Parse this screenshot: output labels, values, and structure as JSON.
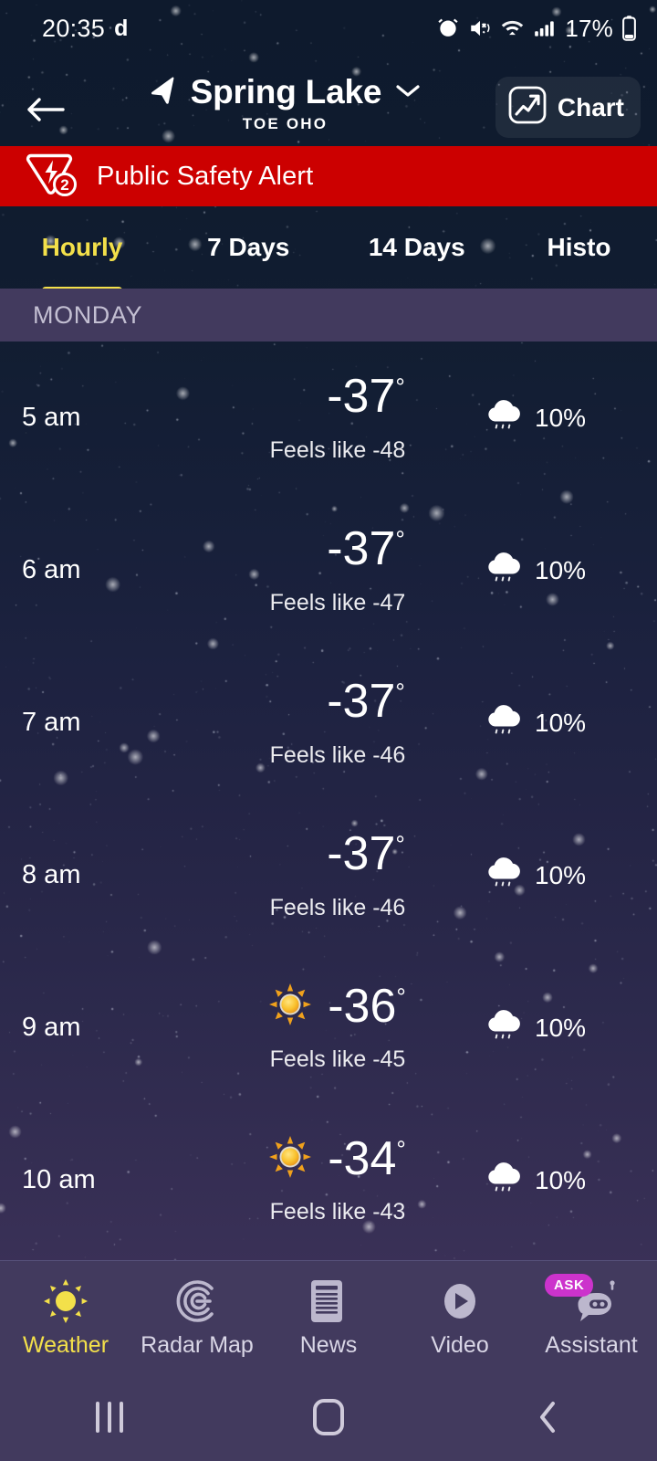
{
  "status_bar": {
    "time": "20:35",
    "do_not_disturb_letter": "d",
    "battery_percent": "17%",
    "icons": [
      "alarm-icon",
      "mute-vibrate-icon",
      "wifi-icon",
      "cellular-signal-icon",
      "battery-icon"
    ]
  },
  "header": {
    "back_icon": "back-arrow-icon",
    "location_icon": "navigation-arrow-icon",
    "title": "Spring Lake",
    "dropdown_icon": "chevron-down-icon",
    "subtitle": "TOE OHO",
    "chart_button": {
      "label": "Chart",
      "icon": "chart-trend-icon"
    }
  },
  "alert": {
    "icon": "warning-triangle-icon",
    "badge_count": "2",
    "text": "Public Safety Alert",
    "background_color": "#cc0000"
  },
  "tabs": {
    "active_index": 0,
    "accent_color": "#f3e04a",
    "items": [
      {
        "label": "Hourly"
      },
      {
        "label": "7 Days"
      },
      {
        "label": "14 Days"
      },
      {
        "label": "Histo"
      }
    ]
  },
  "day_header": {
    "label": "MONDAY",
    "background_color": "#423a5e"
  },
  "hourly": {
    "feels_like_prefix": "Feels like",
    "rows": [
      {
        "time": "5 am",
        "icon": "moon-icon",
        "temp": "-37",
        "degree": "°",
        "feels_like": "Feels like -48",
        "precip_icon": "rain-cloud-icon",
        "precip": "10%"
      },
      {
        "time": "6 am",
        "icon": "moon-icon",
        "temp": "-37",
        "degree": "°",
        "feels_like": "Feels like -47",
        "precip_icon": "rain-cloud-icon",
        "precip": "10%"
      },
      {
        "time": "7 am",
        "icon": "moon-icon",
        "temp": "-37",
        "degree": "°",
        "feels_like": "Feels like -46",
        "precip_icon": "rain-cloud-icon",
        "precip": "10%"
      },
      {
        "time": "8 am",
        "icon": "moon-icon",
        "temp": "-37",
        "degree": "°",
        "feels_like": "Feels like -46",
        "precip_icon": "rain-cloud-icon",
        "precip": "10%"
      },
      {
        "time": "9 am",
        "icon": "sun-icon",
        "temp": "-36",
        "degree": "°",
        "feels_like": "Feels like -45",
        "precip_icon": "rain-cloud-icon",
        "precip": "10%"
      },
      {
        "time": "10 am",
        "icon": "sun-icon",
        "temp": "-34",
        "degree": "°",
        "feels_like": "Feels like -43",
        "precip_icon": "rain-cloud-icon",
        "precip": "10%"
      }
    ]
  },
  "bottom_nav": {
    "active_index": 0,
    "active_color": "#f3e04a",
    "items": [
      {
        "label": "Weather",
        "icon": "sun-icon"
      },
      {
        "label": "Radar Map",
        "icon": "radar-icon"
      },
      {
        "label": "News",
        "icon": "news-document-icon"
      },
      {
        "label": "Video",
        "icon": "play-circle-icon"
      },
      {
        "label": "Assistant",
        "icon": "robot-icon",
        "badge": "ASK",
        "badge_color": "#cc33cc"
      }
    ]
  },
  "system_nav": {
    "recents_icon": "recent-apps-icon",
    "home_icon": "home-icon",
    "back_icon": "back-chevron-icon"
  }
}
